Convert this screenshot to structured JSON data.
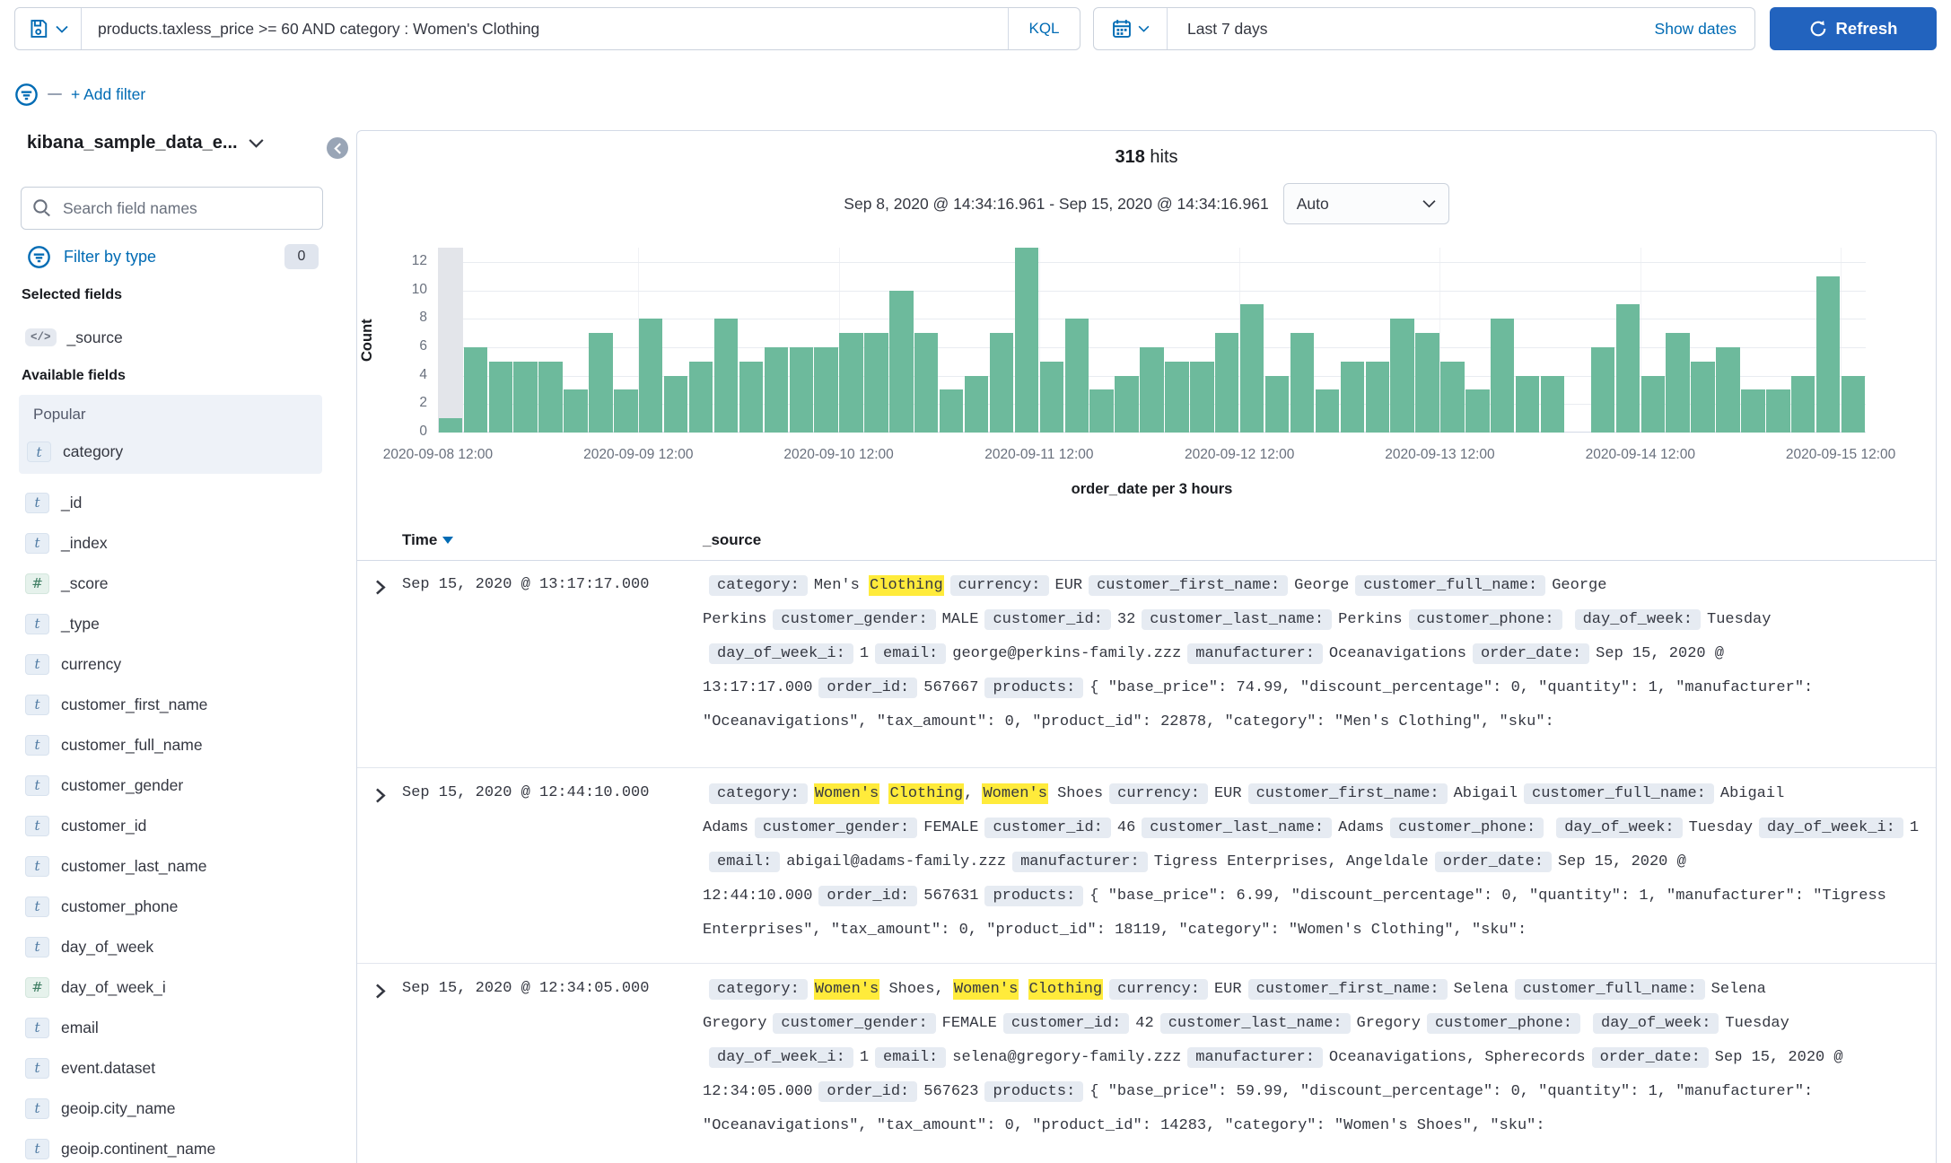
{
  "colors": {
    "accent": "#006BB4",
    "btn": "#2263BE",
    "bar": "#6DBA9C",
    "hl": "#FFEB3B",
    "badge": "#E6EBF2"
  },
  "query_bar": {
    "query": "products.taxless_price >= 60 AND category : Women's Clothing",
    "language": "KQL"
  },
  "filter_bar": {
    "add_filter_label": "+ Add filter"
  },
  "time_picker": {
    "label": "Last 7 days",
    "show_dates_label": "Show dates",
    "refresh_label": "Refresh"
  },
  "sidebar": {
    "index_pattern": "kibana_sample_data_e...",
    "search_placeholder": "Search field names",
    "filter_by_type_label": "Filter by type",
    "filter_count": "0",
    "selected_heading": "Selected fields",
    "source_field": {
      "icon": "</>",
      "name": "_source"
    },
    "available_heading": "Available fields",
    "popular_heading": "Popular",
    "popular_fields": [
      {
        "type": "t",
        "name": "category"
      }
    ],
    "fields": [
      {
        "type": "t",
        "name": "_id"
      },
      {
        "type": "t",
        "name": "_index"
      },
      {
        "type": "#",
        "name": "_score"
      },
      {
        "type": "t",
        "name": "_type"
      },
      {
        "type": "t",
        "name": "currency"
      },
      {
        "type": "t",
        "name": "customer_first_name"
      },
      {
        "type": "t",
        "name": "customer_full_name"
      },
      {
        "type": "t",
        "name": "customer_gender"
      },
      {
        "type": "t",
        "name": "customer_id"
      },
      {
        "type": "t",
        "name": "customer_last_name"
      },
      {
        "type": "t",
        "name": "customer_phone"
      },
      {
        "type": "t",
        "name": "day_of_week"
      },
      {
        "type": "#",
        "name": "day_of_week_i"
      },
      {
        "type": "t",
        "name": "email"
      },
      {
        "type": "t",
        "name": "event.dataset"
      },
      {
        "type": "t",
        "name": "geoip.city_name"
      },
      {
        "type": "t",
        "name": "geoip.continent_name"
      }
    ]
  },
  "results": {
    "hits_count": "318",
    "hits_label": "hits",
    "time_range": "Sep 8, 2020 @ 14:34:16.961 - Sep 15, 2020 @ 14:34:16.961",
    "interval_selector": "Auto"
  },
  "chart_data": {
    "type": "bar",
    "title": "318 hits",
    "ylabel": "Count",
    "xlabel": "order_date per 3 hours",
    "ylim": [
      0,
      13
    ],
    "yticks": [
      0,
      2,
      4,
      6,
      8,
      10,
      12
    ],
    "grid": "horizontal",
    "bucket_interval_hours": 3,
    "xticklabels": [
      "2020-09-08 12:00",
      "2020-09-09 12:00",
      "2020-09-10 12:00",
      "2020-09-11 12:00",
      "2020-09-12 12:00",
      "2020-09-13 12:00",
      "2020-09-14 12:00",
      "2020-09-15 12:00"
    ],
    "values": [
      1,
      6,
      5,
      5,
      5,
      3,
      7,
      3,
      8,
      4,
      5,
      8,
      5,
      6,
      6,
      6,
      7,
      7,
      10,
      7,
      3,
      4,
      7,
      13,
      5,
      8,
      3,
      4,
      6,
      5,
      5,
      7,
      9,
      4,
      7,
      3,
      5,
      5,
      8,
      7,
      5,
      3,
      8,
      4,
      4,
      0,
      6,
      9,
      4,
      7,
      5,
      6,
      3,
      3,
      4,
      11,
      4
    ],
    "partial_bucket_indexes": [
      0
    ]
  },
  "table": {
    "columns": {
      "time": "Time",
      "source": "_source"
    },
    "rows": [
      {
        "time": "Sep 15, 2020 @ 13:17:17.000",
        "tokens": [
          [
            "f",
            "category:"
          ],
          [
            "t",
            "Men's "
          ],
          [
            "m",
            "Clothing"
          ],
          [
            "f",
            "currency:"
          ],
          [
            "t",
            "EUR"
          ],
          [
            "f",
            "customer_first_name:"
          ],
          [
            "t",
            "George"
          ],
          [
            "f",
            "customer_full_name:"
          ],
          [
            "t",
            "George Perkins"
          ],
          [
            "f",
            "customer_gender:"
          ],
          [
            "t",
            "MALE"
          ],
          [
            "f",
            "customer_id:"
          ],
          [
            "t",
            "32"
          ],
          [
            "f",
            "customer_last_name:"
          ],
          [
            "t",
            "Perkins"
          ],
          [
            "f",
            "customer_phone:"
          ],
          [
            "f",
            "day_of_week:"
          ],
          [
            "t",
            "Tuesday"
          ],
          [
            "f",
            "day_of_week_i:"
          ],
          [
            "t",
            "1"
          ],
          [
            "f",
            "email:"
          ],
          [
            "t",
            "george@perkins-family.zzz"
          ],
          [
            "f",
            "manufacturer:"
          ],
          [
            "t",
            "Oceanavigations"
          ],
          [
            "f",
            "order_date:"
          ],
          [
            "t",
            "Sep 15, 2020 @ 13:17:17.000"
          ],
          [
            "f",
            "order_id:"
          ],
          [
            "t",
            "567667"
          ],
          [
            "f",
            "products:"
          ],
          [
            "t",
            "{ \"base_price\": 74.99, \"discount_percentage\": 0, \"quantity\": 1, \"manufacturer\": \"Oceanavigations\", \"tax_amount\": 0, \"product_id\": 22878, \"category\": \"Men's Clothing\", \"sku\":"
          ]
        ]
      },
      {
        "time": "Sep 15, 2020 @ 12:44:10.000",
        "tokens": [
          [
            "f",
            "category:"
          ],
          [
            "m",
            "Women's"
          ],
          [
            "t",
            " "
          ],
          [
            "m",
            "Clothing"
          ],
          [
            "t",
            ", "
          ],
          [
            "m",
            "Women's"
          ],
          [
            "t",
            " Shoes"
          ],
          [
            "f",
            "currency:"
          ],
          [
            "t",
            "EUR"
          ],
          [
            "f",
            "customer_first_name:"
          ],
          [
            "t",
            "Abigail"
          ],
          [
            "f",
            "customer_full_name:"
          ],
          [
            "t",
            "Abigail Adams"
          ],
          [
            "f",
            "customer_gender:"
          ],
          [
            "t",
            "FEMALE"
          ],
          [
            "f",
            "customer_id:"
          ],
          [
            "t",
            "46"
          ],
          [
            "f",
            "customer_last_name:"
          ],
          [
            "t",
            "Adams"
          ],
          [
            "f",
            "customer_phone:"
          ],
          [
            "f",
            "day_of_week:"
          ],
          [
            "t",
            "Tuesday"
          ],
          [
            "f",
            "day_of_week_i:"
          ],
          [
            "t",
            "1"
          ],
          [
            "f",
            "email:"
          ],
          [
            "t",
            "abigail@adams-family.zzz"
          ],
          [
            "f",
            "manufacturer:"
          ],
          [
            "t",
            "Tigress Enterprises, Angeldale"
          ],
          [
            "f",
            "order_date:"
          ],
          [
            "t",
            "Sep 15, 2020 @ 12:44:10.000"
          ],
          [
            "f",
            "order_id:"
          ],
          [
            "t",
            "567631"
          ],
          [
            "f",
            "products:"
          ],
          [
            "t",
            "{ \"base_price\": 6.99, \"discount_percentage\": 0, \"quantity\": 1, \"manufacturer\": \"Tigress Enterprises\", \"tax_amount\": 0, \"product_id\": 18119, \"category\": \"Women's Clothing\", \"sku\":"
          ]
        ]
      },
      {
        "time": "Sep 15, 2020 @ 12:34:05.000",
        "tokens": [
          [
            "f",
            "category:"
          ],
          [
            "m",
            "Women's"
          ],
          [
            "t",
            " Shoes, "
          ],
          [
            "m",
            "Women's"
          ],
          [
            "t",
            " "
          ],
          [
            "m",
            "Clothing"
          ],
          [
            "f",
            "currency:"
          ],
          [
            "t",
            "EUR"
          ],
          [
            "f",
            "customer_first_name:"
          ],
          [
            "t",
            "Selena"
          ],
          [
            "f",
            "customer_full_name:"
          ],
          [
            "t",
            "Selena Gregory"
          ],
          [
            "f",
            "customer_gender:"
          ],
          [
            "t",
            "FEMALE"
          ],
          [
            "f",
            "customer_id:"
          ],
          [
            "t",
            "42"
          ],
          [
            "f",
            "customer_last_name:"
          ],
          [
            "t",
            "Gregory"
          ],
          [
            "f",
            "customer_phone:"
          ],
          [
            "f",
            "day_of_week:"
          ],
          [
            "t",
            "Tuesday"
          ],
          [
            "f",
            "day_of_week_i:"
          ],
          [
            "t",
            "1"
          ],
          [
            "f",
            "email:"
          ],
          [
            "t",
            "selena@gregory-family.zzz"
          ],
          [
            "f",
            "manufacturer:"
          ],
          [
            "t",
            "Oceanavigations, Spherecords"
          ],
          [
            "f",
            "order_date:"
          ],
          [
            "t",
            "Sep 15, 2020 @ 12:34:05.000"
          ],
          [
            "f",
            "order_id:"
          ],
          [
            "t",
            "567623"
          ],
          [
            "f",
            "products:"
          ],
          [
            "t",
            "{ \"base_price\": 59.99, \"discount_percentage\": 0, \"quantity\": 1, \"manufacturer\": \"Oceanavigations\", \"tax_amount\": 0, \"product_id\": 14283, \"category\": \"Women's Shoes\", \"sku\":"
          ]
        ]
      }
    ]
  }
}
